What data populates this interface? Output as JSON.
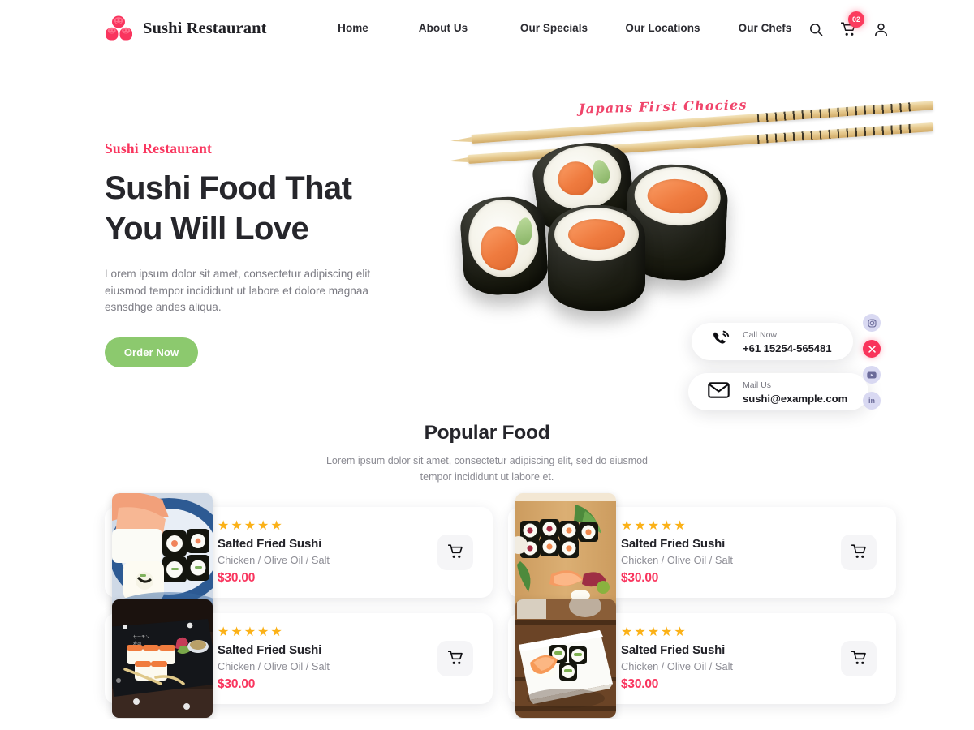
{
  "header": {
    "brand": {
      "name": "Sushi Restaurant",
      "logo_icon": "sushi-roll-logo-icon",
      "logo_color": "#F9355E"
    },
    "nav": [
      {
        "label": "Home"
      },
      {
        "label": "About Us"
      },
      {
        "label": "Our Specials"
      },
      {
        "label": "Our Locations"
      },
      {
        "label": "Our Chefs"
      }
    ],
    "actions": {
      "search_icon": "search-icon",
      "cart_icon": "cart-icon",
      "cart_badge": "02",
      "account_icon": "user-icon"
    }
  },
  "hero": {
    "eyebrow": "Sushi Restaurant",
    "title_line1": "Sushi Food That",
    "title_line2": "You Will Love",
    "description": "Lorem ipsum dolor sit amet, consectetur adipiscing elit eiusmod tempor incididunt ut labore et dolore magnaa esnsdhge andes aliqua.",
    "cta_label": "Order Now",
    "cta_color": "#8CC96E",
    "script_tag": "Japans First Chocies",
    "script_color": "#F0456B",
    "contacts": [
      {
        "icon": "phone-ring-icon",
        "label": "Call Now",
        "value": "+61 15254-565481"
      },
      {
        "icon": "envelope-icon",
        "label": "Mail Us",
        "value": "sushi@example.com"
      }
    ],
    "socials": [
      {
        "icon": "instagram-icon",
        "name": "instagram",
        "active": false
      },
      {
        "icon": "x-twitter-icon",
        "name": "x",
        "active": true
      },
      {
        "icon": "youtube-icon",
        "name": "youtube",
        "active": false
      },
      {
        "icon": "linkedin-icon",
        "name": "linkedin",
        "active": false
      }
    ]
  },
  "popular": {
    "title": "Popular Food",
    "subtitle": "Lorem ipsum dolor sit amet, consectetur adipiscing elit, sed do eiusmod tempor incididunt ut labore et.",
    "cards": [
      {
        "name": "Salted Fried Sushi",
        "ingredients": "Chicken / Olive Oil / Salt",
        "price": "$30.00",
        "rating": 5,
        "image_alt": "sushi-plate-blue-china"
      },
      {
        "name": "Salted Fried Sushi",
        "ingredients": "Chicken / Olive Oil / Salt",
        "price": "$30.00",
        "rating": 5,
        "image_alt": "sushi-wooden-board"
      },
      {
        "name": "Salted Fried Sushi",
        "ingredients": "Chicken / Olive Oil / Salt",
        "price": "$30.00",
        "rating": 5,
        "image_alt": "sushi-dark-slate"
      },
      {
        "name": "Salted Fried Sushi",
        "ingredients": "Chicken / Olive Oil / Salt",
        "price": "$30.00",
        "rating": 5,
        "image_alt": "sushi-white-plate-wood"
      }
    ],
    "cart_button_icon": "cart-icon",
    "price_color": "#F9355E",
    "star_color": "#FBB117"
  }
}
